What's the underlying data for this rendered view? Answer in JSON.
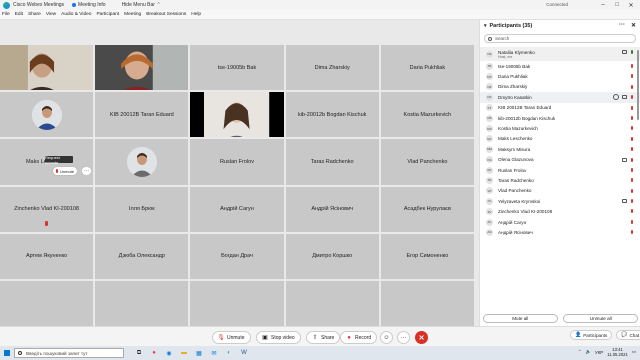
{
  "titlebar": {
    "app_name": "Cisco Webex Meetings",
    "meeting_info": "Meeting Info",
    "hide_menu": "Hide Menu Bar ⌃",
    "status": "Connected"
  },
  "menubar": [
    "File",
    "Edit",
    "Share",
    "View",
    "Audio & Video",
    "Participant",
    "Meeting",
    "Breakout Sessions",
    "Help"
  ],
  "grid": {
    "tiles": [
      {
        "name": "",
        "kind": "video1"
      },
      {
        "name": "",
        "kind": "video2"
      },
      {
        "name": "tse-19005b Bak",
        "kind": "name"
      },
      {
        "name": "Dima Zharskiy",
        "kind": "name"
      },
      {
        "name": "Daria Pukhliak",
        "kind": "name"
      },
      {
        "name": "",
        "kind": "avatar"
      },
      {
        "name": "KIB 20012B Taran Eduard",
        "kind": "name"
      },
      {
        "name": "",
        "kind": "video3"
      },
      {
        "name": "kib-20012b Bogdan Kischuk",
        "kind": "name"
      },
      {
        "name": "Kostia Mazurkevich",
        "kind": "name"
      },
      {
        "name": "Maks Leschenko",
        "kind": "name"
      },
      {
        "name": "",
        "kind": "avatar"
      },
      {
        "name": "Ruslan Frolov",
        "kind": "name"
      },
      {
        "name": "Taras Radchenko",
        "kind": "name"
      },
      {
        "name": "Vlad Panchenko",
        "kind": "name"
      },
      {
        "name": "Zinchenko Vlad KI-200108",
        "kind": "name"
      },
      {
        "name": "Ілля Брюк",
        "kind": "name"
      },
      {
        "name": "Андрій Сагун",
        "kind": "name"
      },
      {
        "name": "Андрій Ясінович",
        "kind": "name"
      },
      {
        "name": "Асадбек Нурулаєв",
        "kind": "name"
      },
      {
        "name": "Артем Якуненко",
        "kind": "name"
      },
      {
        "name": "Дзюба Олександр",
        "kind": "name"
      },
      {
        "name": "Богдан Драч",
        "kind": "name"
      },
      {
        "name": "Дмитро Коршко",
        "kind": "name"
      },
      {
        "name": "Егор Симоненко",
        "kind": "name"
      },
      {
        "name": "",
        "kind": "empty"
      },
      {
        "name": "",
        "kind": "empty"
      },
      {
        "name": "",
        "kind": "empty"
      },
      {
        "name": "",
        "kind": "empty"
      },
      {
        "name": "",
        "kind": "empty"
      }
    ],
    "tooltip": "Request unmute",
    "unmute_pill": "Unmute",
    "more_pill": "···"
  },
  "controls": {
    "unmute": "Unmute",
    "stop_video": "Stop video",
    "share": "Share",
    "record": "Record",
    "more": "···",
    "end": "✕"
  },
  "panel": {
    "title": "Participants (35)",
    "search_placeholder": "Search",
    "participants": [
      {
        "initials": "NK",
        "name": "Nataliia Klymenko",
        "sub": "Host, me",
        "mic": "on"
      },
      {
        "initials": "TB",
        "name": "tse-19005b Bak",
        "mic": "off"
      },
      {
        "initials": "DP",
        "name": "Daria Pukhliak",
        "mic": "off"
      },
      {
        "initials": "DZ",
        "name": "Dima Zharskiy",
        "mic": "off"
      },
      {
        "initials": "DK",
        "name": "Dmytro Kasatkin",
        "mic": "off"
      },
      {
        "initials": "KT",
        "name": "KIB 20012B Taran Eduard",
        "mic": "off"
      },
      {
        "initials": "KB",
        "name": "kib-20012b Bogdan Kischuk",
        "mic": "off"
      },
      {
        "initials": "KM",
        "name": "Kostia Mazurkevich",
        "mic": "off"
      },
      {
        "initials": "ML",
        "name": "Maks Leschenko",
        "mic": "off"
      },
      {
        "initials": "MM",
        "name": "Maksym Misura",
        "mic": "off"
      },
      {
        "initials": "OG",
        "name": "Olena Glazunova",
        "mic": "off"
      },
      {
        "initials": "RF",
        "name": "Ruslan Frolov",
        "mic": "off"
      },
      {
        "initials": "TR",
        "name": "Taras Radchenko",
        "mic": "off"
      },
      {
        "initials": "VP",
        "name": "Vlad Panchenko",
        "mic": "off"
      },
      {
        "initials": "YK",
        "name": "Yelyzaveta Krymskoi",
        "mic": "off"
      },
      {
        "initials": "ZV",
        "name": "Zinchenko Vlad KI-200108",
        "mic": "off"
      },
      {
        "initials": "АС",
        "name": "Андрій Сагун",
        "mic": "off"
      },
      {
        "initials": "АЯ",
        "name": "Андрій Ясінович",
        "mic": "off"
      }
    ],
    "mute_all": "Mute all",
    "unmute_all": "Unmute all"
  },
  "side_tabs": {
    "participants": "Participants",
    "chat": "Chat"
  },
  "taskbar": {
    "search_placeholder": "Введіть пошуковий запит тут",
    "lang": "УКР",
    "time": "13:41",
    "date": "11.05.2021"
  },
  "colors": {
    "accent": "#1a73e8",
    "end": "#d93025",
    "muted": "#d33"
  }
}
